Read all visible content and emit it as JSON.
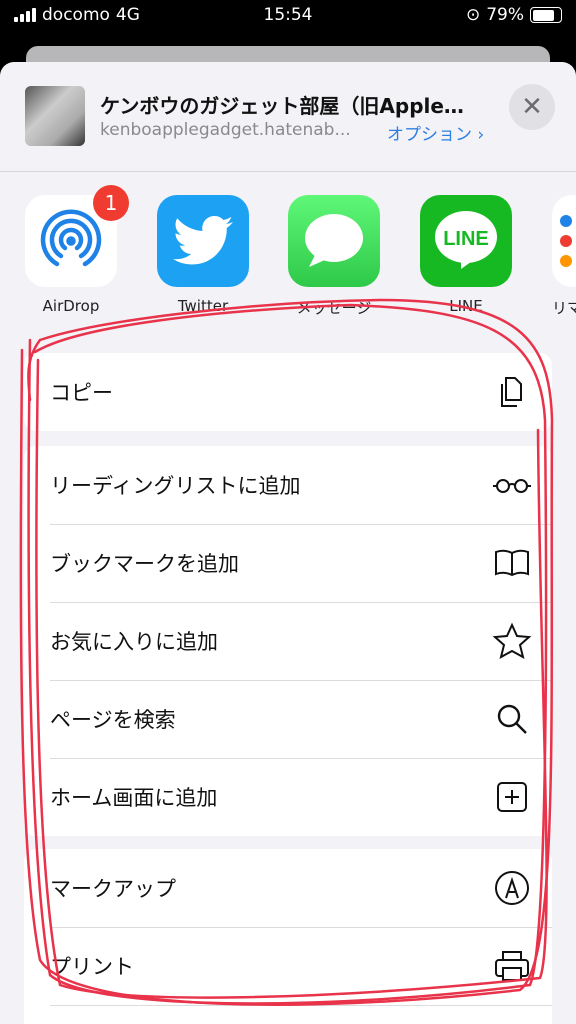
{
  "status": {
    "carrier": "docomo",
    "network": "4G",
    "time": "15:54",
    "battery": "79%"
  },
  "header": {
    "title": "ケンボウのガジェット部屋（旧Apple…",
    "url": "kenboapplegadget.hatenab...",
    "options": "オプション ›",
    "close": "✕"
  },
  "apps": [
    {
      "label": "AirDrop",
      "badge": "1",
      "icon": "airdrop-icon"
    },
    {
      "label": "Twitter",
      "icon": "twitter-icon"
    },
    {
      "label": "メッセージ",
      "icon": "messages-icon",
      "logo": ""
    },
    {
      "label": "LINE",
      "icon": "line-icon",
      "logo": "LINE"
    },
    {
      "label": "リマ",
      "icon": "reminders-icon"
    }
  ],
  "actions": {
    "group1": [
      {
        "label": "コピー",
        "icon": "copy-icon"
      }
    ],
    "group2": [
      {
        "label": "リーディングリストに追加",
        "icon": "glasses-icon"
      },
      {
        "label": "ブックマークを追加",
        "icon": "book-icon"
      },
      {
        "label": "お気に入りに追加",
        "icon": "star-icon"
      },
      {
        "label": "ページを検索",
        "icon": "search-icon"
      },
      {
        "label": "ホーム画面に追加",
        "icon": "add-square-icon"
      }
    ],
    "group3": [
      {
        "label": "マークアップ",
        "icon": "markup-icon"
      },
      {
        "label": "プリント",
        "icon": "print-icon"
      }
    ]
  },
  "colors": {
    "accent": "#2f7fe0",
    "annotation": "#e8334a",
    "twitter": "#1da1f2",
    "messages": "#34c759",
    "line": "#06c755"
  }
}
